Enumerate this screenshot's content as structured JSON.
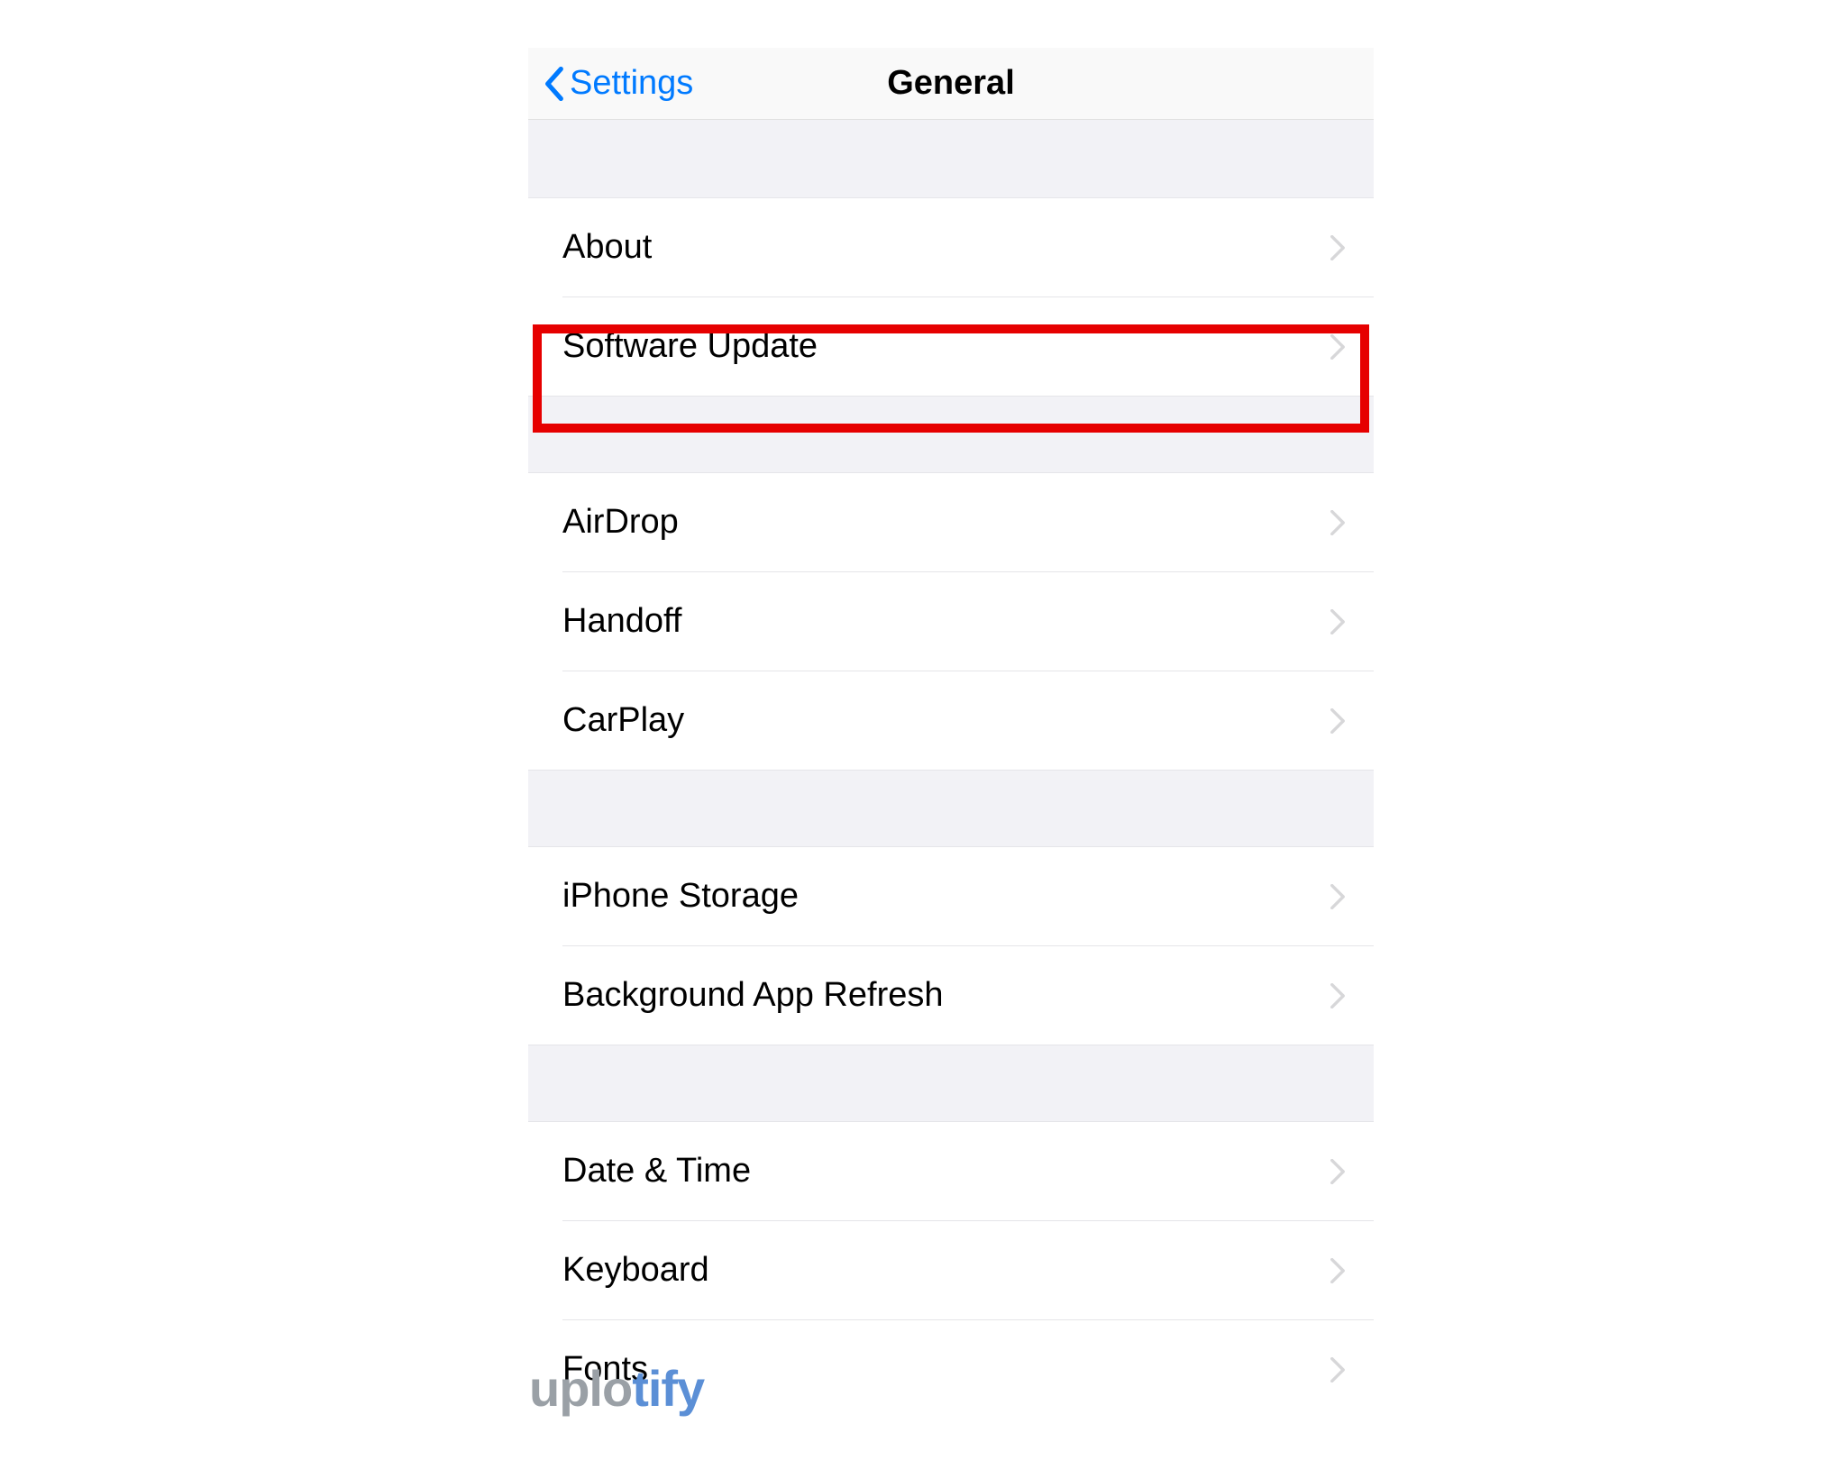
{
  "nav": {
    "back_label": "Settings",
    "title": "General"
  },
  "sections": [
    {
      "rows": [
        {
          "label": "About",
          "name": "row-about"
        },
        {
          "label": "Software Update",
          "name": "row-software-update",
          "highlight": true
        }
      ]
    },
    {
      "rows": [
        {
          "label": "AirDrop",
          "name": "row-airdrop"
        },
        {
          "label": "Handoff",
          "name": "row-handoff"
        },
        {
          "label": "CarPlay",
          "name": "row-carplay"
        }
      ]
    },
    {
      "rows": [
        {
          "label": "iPhone Storage",
          "name": "row-iphone-storage"
        },
        {
          "label": "Background App Refresh",
          "name": "row-background-app-refresh"
        }
      ]
    },
    {
      "rows": [
        {
          "label": "Date & Time",
          "name": "row-date-time"
        },
        {
          "label": "Keyboard",
          "name": "row-keyboard"
        },
        {
          "label": "Fonts",
          "name": "row-fonts"
        }
      ]
    }
  ],
  "watermark": {
    "part1": "uplo",
    "part2": "tify"
  },
  "colors": {
    "accent": "#007aff",
    "highlight": "#e60000"
  }
}
